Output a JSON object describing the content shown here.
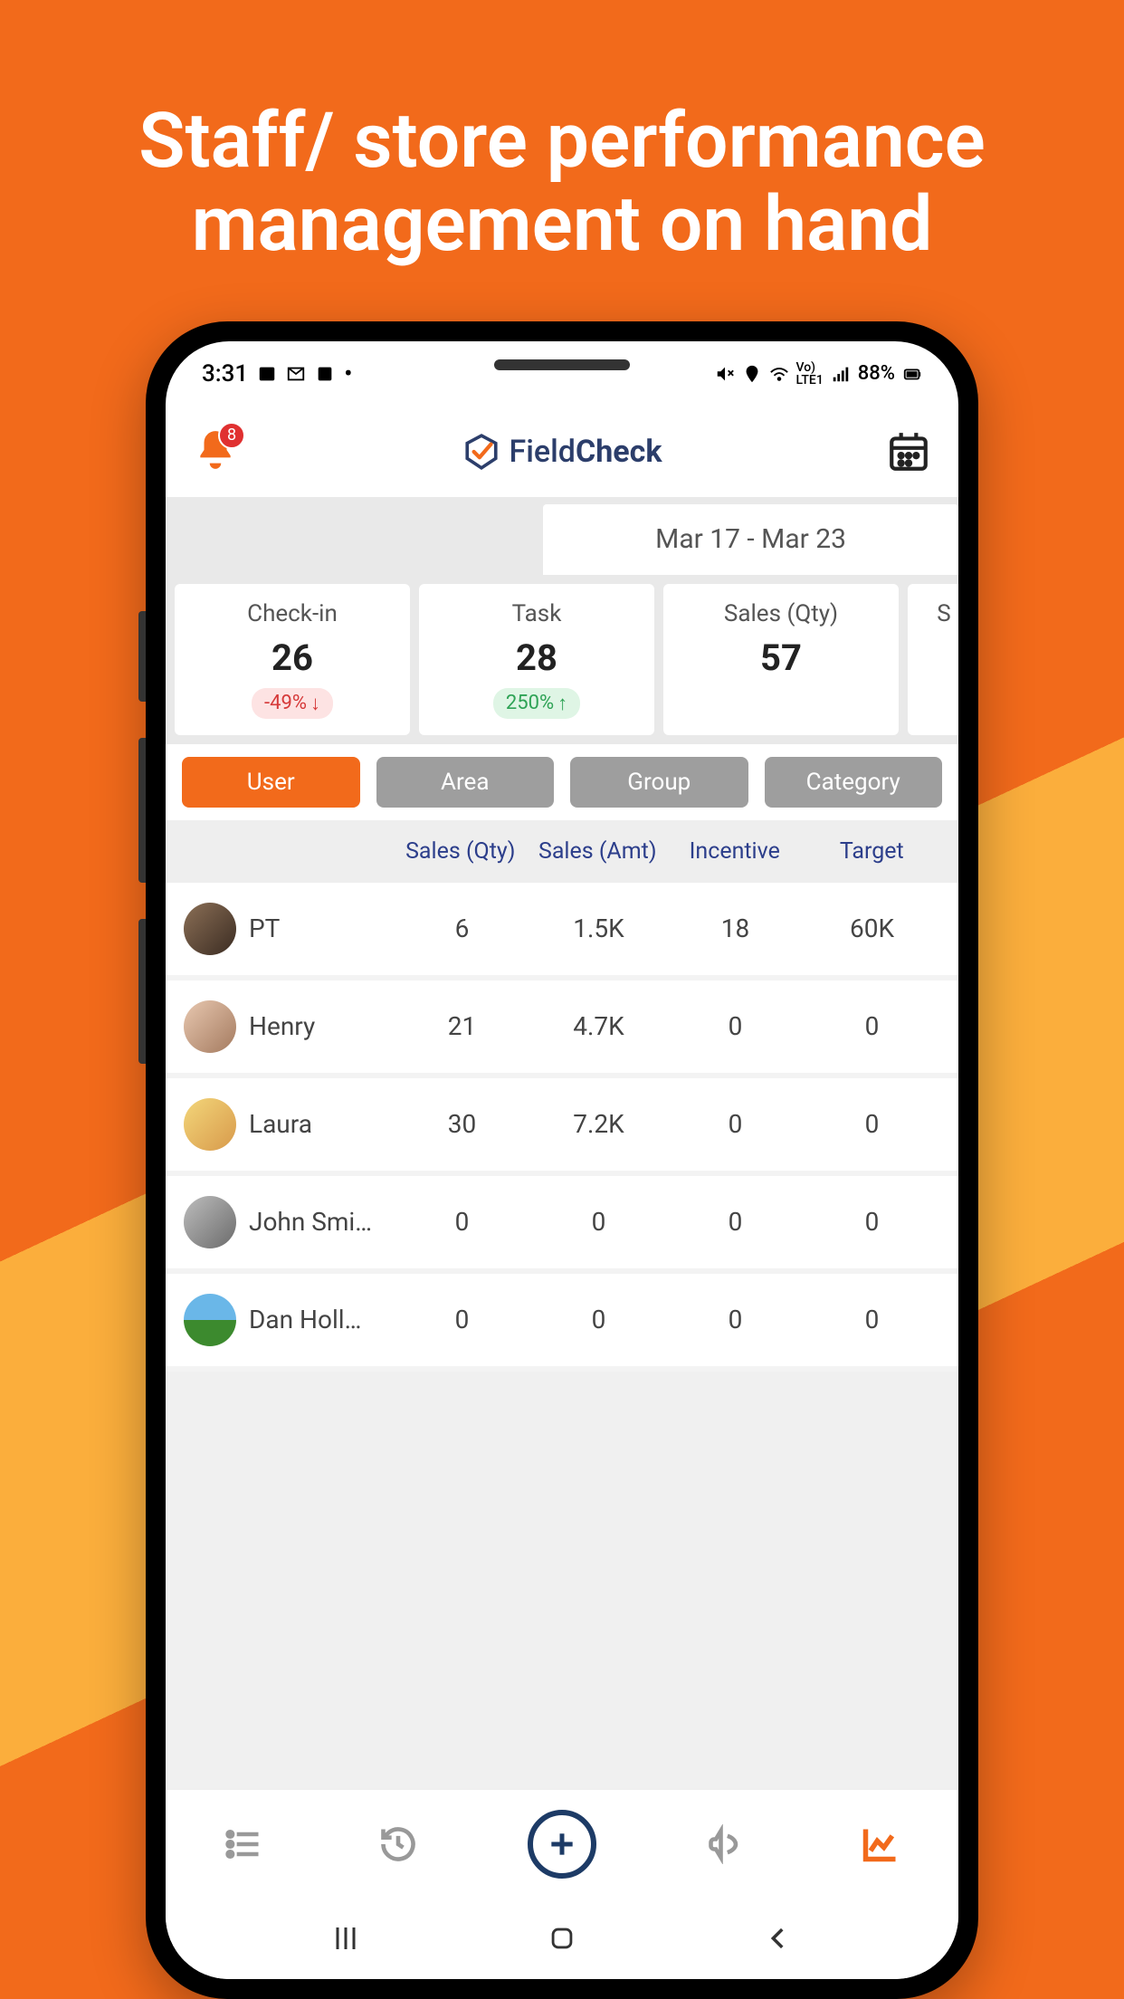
{
  "marketing_title": "Staff/ store performance management on hand",
  "status": {
    "time": "3:31",
    "battery": "88%"
  },
  "header": {
    "notification_count": "8",
    "logo_a": "Field",
    "logo_b": "Check"
  },
  "date_range": "Mar 17 - Mar 23",
  "stats": [
    {
      "label": "Check-in",
      "value": "26",
      "delta": "-49%",
      "dir": "down"
    },
    {
      "label": "Task",
      "value": "28",
      "delta": "250%",
      "dir": "up"
    },
    {
      "label": "Sales (Qty)",
      "value": "57",
      "delta": "",
      "dir": ""
    },
    {
      "label": "S",
      "value": "",
      "delta": "",
      "dir": ""
    }
  ],
  "filters": [
    "User",
    "Area",
    "Group",
    "Category"
  ],
  "filter_active": 0,
  "columns": [
    "Sales (Qty)",
    "Sales (Amt)",
    "Incentive",
    "Target"
  ],
  "rows": [
    {
      "name": "PT",
      "cells": [
        "6",
        "1.5K",
        "18",
        "60K"
      ],
      "av": "av-pt"
    },
    {
      "name": "Henry",
      "cells": [
        "21",
        "4.7K",
        "0",
        "0"
      ],
      "av": "av-henry"
    },
    {
      "name": "Laura",
      "cells": [
        "30",
        "7.2K",
        "0",
        "0"
      ],
      "av": "av-laura"
    },
    {
      "name": "John Smi…",
      "cells": [
        "0",
        "0",
        "0",
        "0"
      ],
      "av": "av-john"
    },
    {
      "name": "Dan Holl…",
      "cells": [
        "0",
        "0",
        "0",
        "0"
      ],
      "av": "av-dan"
    }
  ]
}
